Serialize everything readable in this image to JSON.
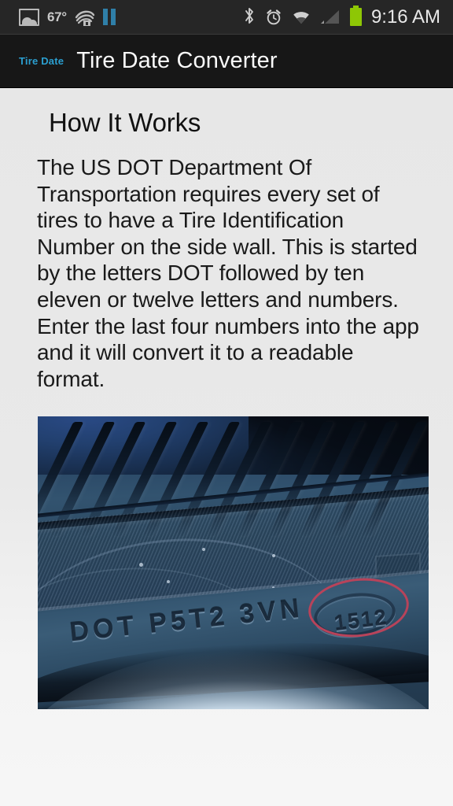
{
  "status_bar": {
    "temperature": "67°",
    "clock": "9:16 AM",
    "icons": [
      {
        "name": "photo-icon",
        "label": "gallery"
      },
      {
        "name": "audible-icon",
        "label": "audible"
      },
      {
        "name": "pause-icon",
        "label": "media-paused"
      },
      {
        "name": "bluetooth-icon",
        "label": "bluetooth",
        "glyph": "ᛗ"
      },
      {
        "name": "alarm-icon",
        "label": "alarm"
      },
      {
        "name": "wifi-icon",
        "label": "wifi"
      },
      {
        "name": "signal-icon",
        "label": "cellular-signal"
      },
      {
        "name": "battery-icon",
        "label": "battery"
      }
    ],
    "colors": {
      "background": "#262626",
      "icon": "#c9c9c9",
      "battery": "#8ec705",
      "pause": "#2f7fa8"
    }
  },
  "action_bar": {
    "logo_text": "Tire Date",
    "title": "Tire Date Converter",
    "colors": {
      "background": "#171717",
      "logo": "#2b9fd0",
      "title": "#fafafa"
    }
  },
  "main": {
    "heading": "How It Works",
    "paragraph": "The US DOT Department Of Transportation requires every set of tires to have a Tire Identification Number on the side wall. This is started by the letters DOT followed by ten eleven or twelve letters and numbers. Enter the last four numbers into the app and it will convert it to a readable format.",
    "photo": {
      "alt": "tire-sidewall-photo",
      "dot_code": "DOT  P5T2 3VN",
      "date_code": "1512",
      "highlight_color": "#b8435a"
    },
    "colors": {
      "background": "#e9e9e9",
      "heading": "#111111",
      "text": "#1a1a1a"
    }
  }
}
